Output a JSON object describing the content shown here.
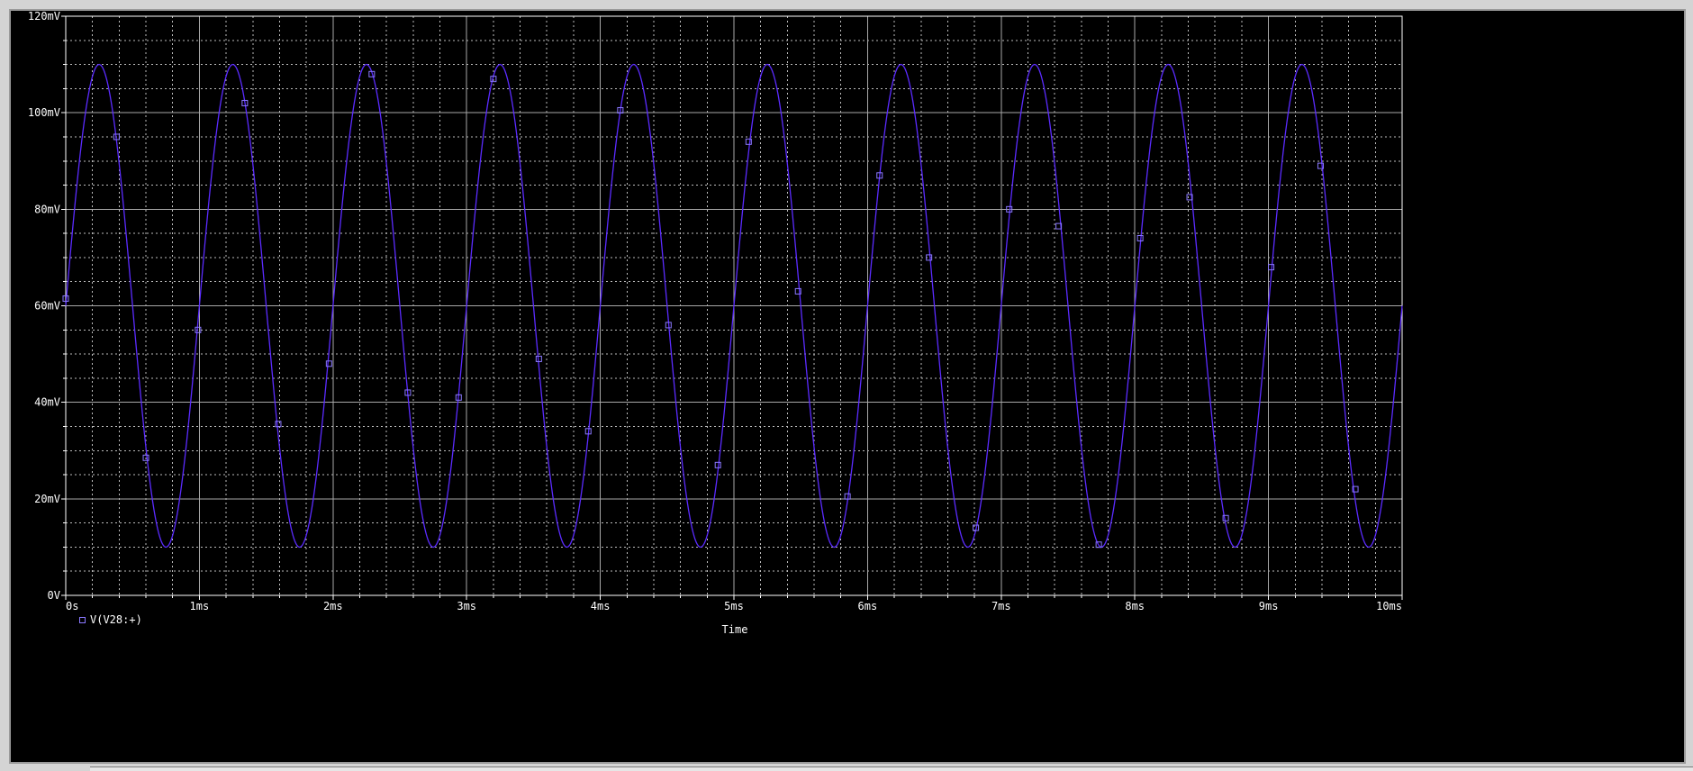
{
  "colors": {
    "background": "#000000",
    "grid_major": "#a8a8a8",
    "grid_minor": "#bdbdbd",
    "axis": "#ffffff",
    "trace": "#5b2bff",
    "marker": "#8a78ff",
    "text": "#ffffff"
  },
  "chart_data": {
    "type": "line",
    "title": "",
    "xlabel": "Time",
    "ylabel": "",
    "xlim": [
      0,
      10
    ],
    "ylim": [
      0,
      120
    ],
    "x_unit": "ms",
    "y_unit": "mV",
    "x_tick_values": [
      0,
      1,
      2,
      3,
      4,
      5,
      6,
      7,
      8,
      9,
      10
    ],
    "x_tick_labels": [
      "0s",
      "1ms",
      "2ms",
      "3ms",
      "4ms",
      "5ms",
      "6ms",
      "7ms",
      "8ms",
      "9ms",
      "10ms"
    ],
    "y_tick_values": [
      0,
      20,
      40,
      60,
      80,
      100,
      120
    ],
    "y_tick_labels": [
      "0V",
      "20mV",
      "40mV",
      "60mV",
      "80mV",
      "100mV",
      "120mV"
    ],
    "grid": true,
    "legend": {
      "position": "bottom-left",
      "entries": [
        "V(V28:+)"
      ]
    },
    "series": [
      {
        "name": "V(V28:+)",
        "marker": "square",
        "signal": {
          "waveform": "sine",
          "offset_mV": 60,
          "amplitude_mV": 50,
          "frequency_kHz": 1,
          "phase_deg": 0
        },
        "marker_points": [
          {
            "x": 0.0,
            "y": 61.5
          },
          {
            "x": 0.38,
            "y": 95
          },
          {
            "x": 0.6,
            "y": 28.5
          },
          {
            "x": 0.99,
            "y": 55
          },
          {
            "x": 1.34,
            "y": 102
          },
          {
            "x": 1.59,
            "y": 35.5
          },
          {
            "x": 1.97,
            "y": 48
          },
          {
            "x": 2.29,
            "y": 108
          },
          {
            "x": 2.56,
            "y": 42
          },
          {
            "x": 2.94,
            "y": 41
          },
          {
            "x": 3.2,
            "y": 107
          },
          {
            "x": 3.54,
            "y": 49
          },
          {
            "x": 3.91,
            "y": 34
          },
          {
            "x": 4.15,
            "y": 100.5
          },
          {
            "x": 4.51,
            "y": 56
          },
          {
            "x": 4.88,
            "y": 27
          },
          {
            "x": 5.11,
            "y": 94
          },
          {
            "x": 5.48,
            "y": 63
          },
          {
            "x": 5.85,
            "y": 20.5
          },
          {
            "x": 6.09,
            "y": 87
          },
          {
            "x": 6.46,
            "y": 70
          },
          {
            "x": 6.81,
            "y": 14
          },
          {
            "x": 7.06,
            "y": 80
          },
          {
            "x": 7.43,
            "y": 76.5
          },
          {
            "x": 7.73,
            "y": 10.5
          },
          {
            "x": 8.04,
            "y": 74
          },
          {
            "x": 8.41,
            "y": 82.5
          },
          {
            "x": 8.68,
            "y": 16
          },
          {
            "x": 9.02,
            "y": 68
          },
          {
            "x": 9.39,
            "y": 89
          },
          {
            "x": 9.65,
            "y": 22
          }
        ]
      }
    ]
  }
}
